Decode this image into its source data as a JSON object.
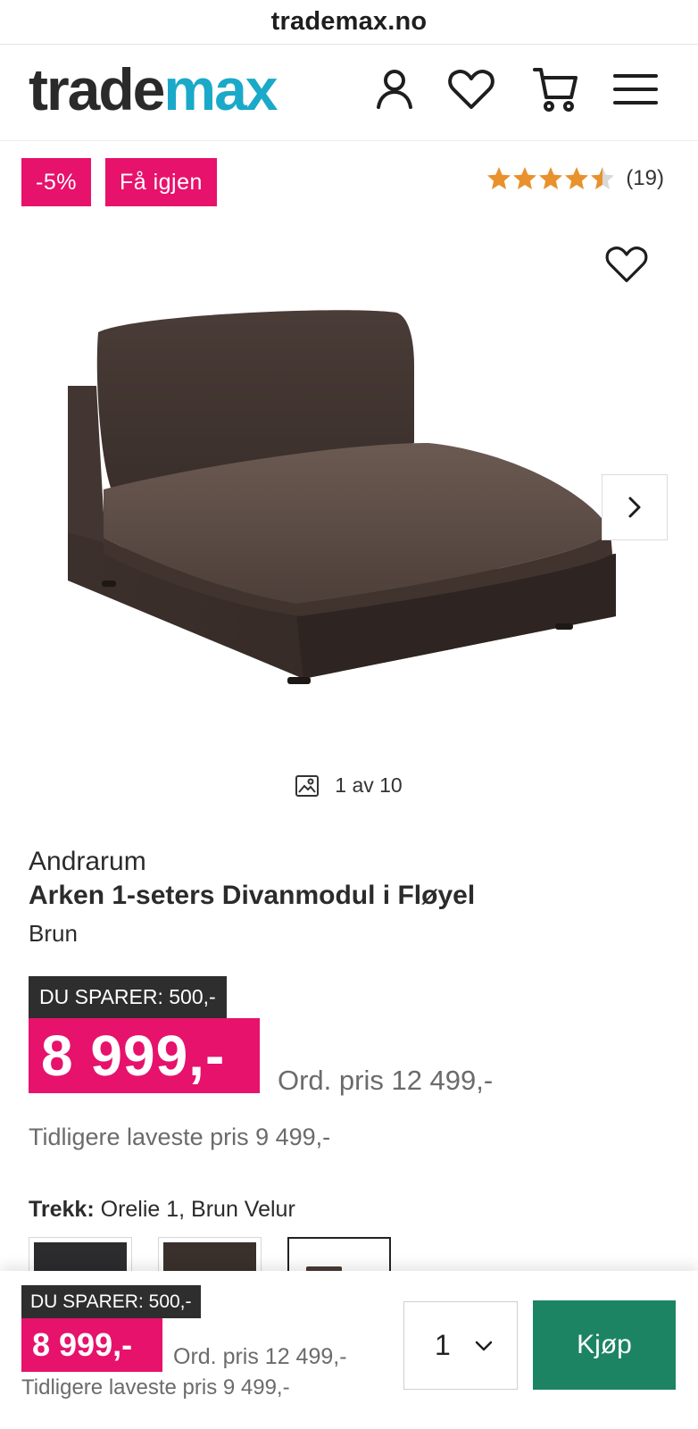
{
  "browser": {
    "url": "trademax.no"
  },
  "header": {
    "logo_part1": "trade",
    "logo_part2": "max",
    "icons": [
      "user-icon",
      "heart-icon",
      "cart-icon",
      "menu-icon"
    ]
  },
  "badges": {
    "discount": "-5%",
    "restock": "Få igjen"
  },
  "rating": {
    "stars": 4.5,
    "max": 5,
    "count": "(19)"
  },
  "gallery": {
    "counter": "1 av 10"
  },
  "product": {
    "brand": "Andrarum",
    "title": "Arken 1-seters Divanmodul i Fløyel",
    "color": "Brun"
  },
  "pricing": {
    "save_label": "DU SPARER: 500,-",
    "price": "8 999,-",
    "ord_price": "Ord. pris 12 499,-",
    "prev_lowest": "Tidligere laveste pris 9 499,-"
  },
  "options": {
    "trekk_label": "Trekk:",
    "trekk_value": "Orelie 1, Brun Velur",
    "swatches": [
      {
        "color": "#2c2c2e",
        "selected": false
      },
      {
        "color": "#3a302c",
        "selected": false
      },
      {
        "color": "#ffffff",
        "selected": true
      }
    ]
  },
  "sticky_bar": {
    "save_label": "DU SPARER: 500,-",
    "price": "8 999,-",
    "ord_price": "Ord. pris 12 499,-",
    "prev_lowest": "Tidligere laveste pris 9 499,-",
    "quantity": "1",
    "buy_label": "Kjøp"
  },
  "colors": {
    "accent": "#e6126c",
    "logo_blue": "#1aa9c9",
    "buy_green": "#1d8463",
    "star": "#e8912d"
  }
}
